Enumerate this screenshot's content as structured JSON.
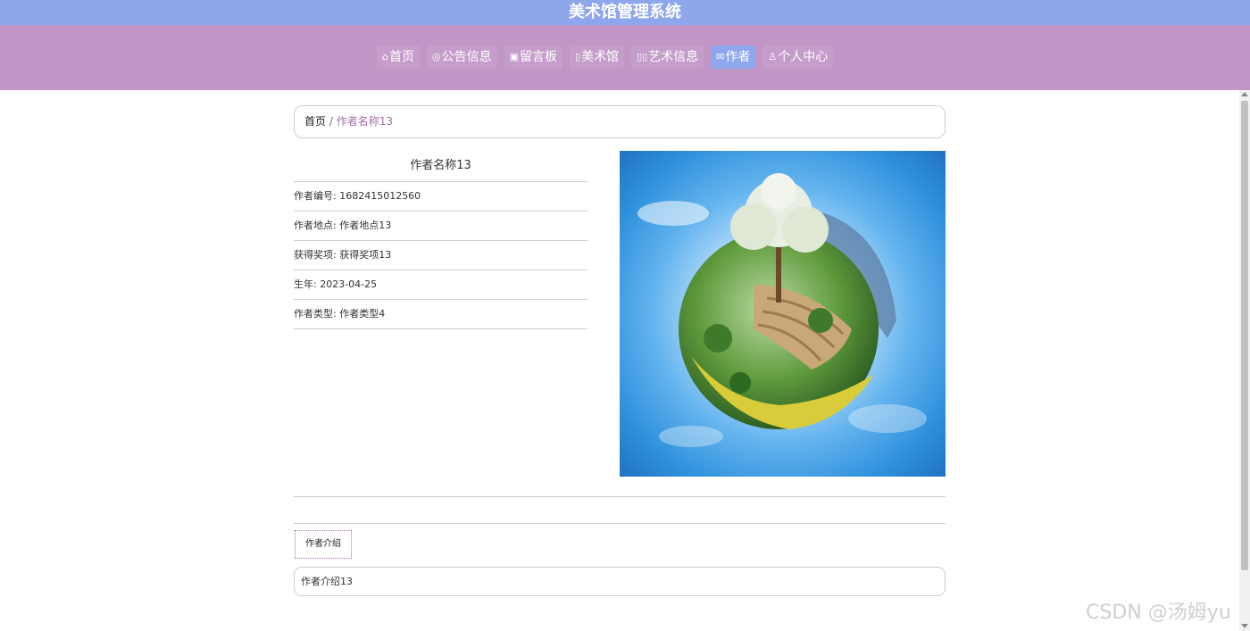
{
  "header": {
    "title": "美术馆管理系统"
  },
  "nav": {
    "items": [
      {
        "icon": "home-icon",
        "label": "首页"
      },
      {
        "icon": "announcement-icon",
        "label": "公告信息"
      },
      {
        "icon": "message-board-icon",
        "label": "留言板"
      },
      {
        "icon": "gallery-icon",
        "label": "美术馆"
      },
      {
        "icon": "art-info-icon",
        "label": "艺术信息"
      },
      {
        "icon": "author-icon",
        "label": "作者"
      },
      {
        "icon": "user-icon",
        "label": "个人中心"
      }
    ],
    "active": "作者"
  },
  "breadcrumb": {
    "home": "首页",
    "separator": "/",
    "current": "作者名称13"
  },
  "detail": {
    "name": "作者名称13",
    "rows": [
      "作者编号: 1682415012560",
      "作者地点: 作者地点13",
      "获得奖项: 获得奖项13",
      "生年: 2023-04-25",
      "作者类型: 作者类型4"
    ]
  },
  "tabs": {
    "intro_tab": "作者介绍"
  },
  "intro": {
    "text": "作者介绍13"
  },
  "watermark": "CSDN @汤姆yu",
  "colors": {
    "topbar": "#8ea6ec",
    "navbar": "#c195c6",
    "active_nav": "#8ea6ec",
    "breadcrumb_current": "#a56aa6"
  }
}
